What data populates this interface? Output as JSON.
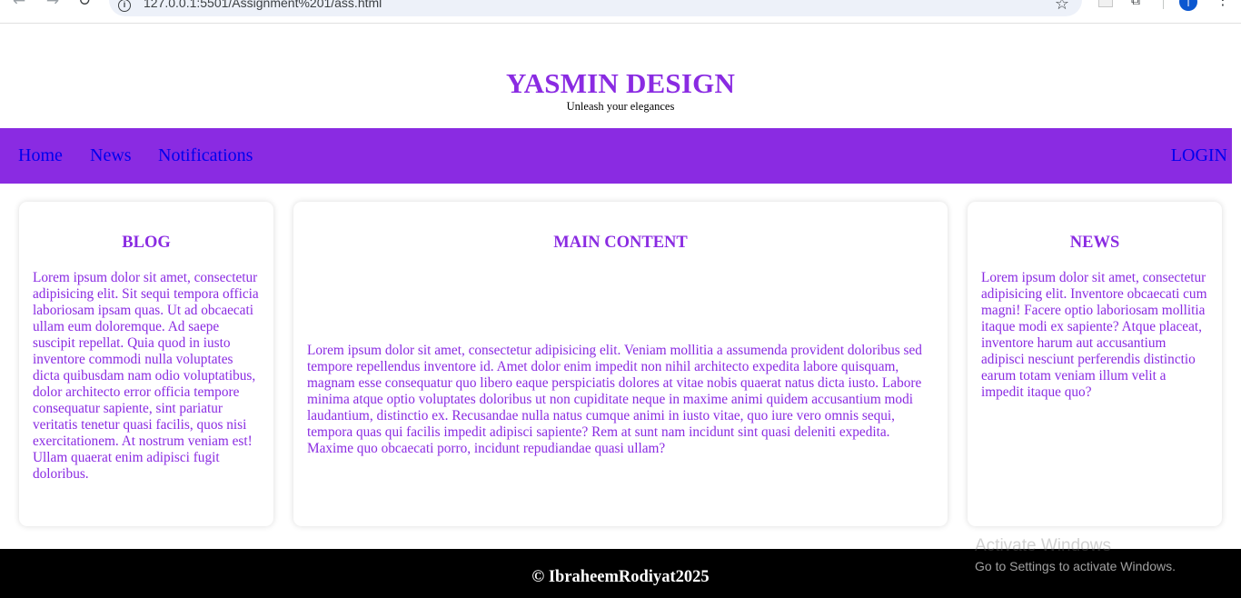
{
  "browser": {
    "url": "127.0.0.1:5501/Assignment%201/ass.html",
    "back_icon": "←",
    "forward_icon": "→",
    "reload_icon": "↻",
    "info_icon": "i",
    "star_icon": "☆",
    "extensions_icon": "⧉",
    "profile_initial": "I",
    "menu_icon": "⋮"
  },
  "header": {
    "title": "YASMIN DESIGN",
    "tagline": "Unleash your elegances"
  },
  "nav": {
    "home": "Home",
    "news": "News",
    "notifications": "Notifications",
    "login": "LOGIN"
  },
  "blog": {
    "heading": "BLOG",
    "body": "Lorem ipsum dolor sit amet, consectetur adipisicing elit. Sit sequi tempora officia laboriosam ipsam quas. Ut ad obcaecati ullam eum doloremque. Ad saepe suscipit repellat. Quia quod in iusto inventore commodi nulla voluptates dicta quibusdam nam odio voluptatibus, dolor architecto error officia tempore consequatur sapiente, sint pariatur veritatis tenetur quasi facilis, quos nisi exercitationem. At nostrum veniam est! Ullam quaerat enim adipisci fugit doloribus."
  },
  "main": {
    "heading": "MAIN CONTENT",
    "body": "Lorem ipsum dolor sit amet, consectetur adipisicing elit. Veniam mollitia a assumenda provident doloribus sed tempore repellendus inventore id. Amet dolor enim impedit non nihil architecto expedita labore quisquam, magnam esse consequatur quo libero eaque perspiciatis dolores at vitae nobis quaerat natus dicta iusto. Labore minima atque optio voluptates doloribus ut non cupiditate neque in maxime animi quidem accusantium modi laudantium, distinctio ex. Recusandae nulla natus cumque animi in iusto vitae, quo iure vero omnis sequi, tempora quas qui facilis impedit adipisci sapiente? Rem at sunt nam incidunt sint quasi deleniti expedita. Maxime quo obcaecati porro, incidunt repudiandae quasi ullam?"
  },
  "news": {
    "heading": "NEWS",
    "body": "Lorem ipsum dolor sit amet, consectetur adipisicing elit. Inventore obcaecati cum magni! Facere optio laboriosam mollitia itaque modi ex sapiente? Atque placeat, inventore harum aut accusantium adipisci nesciunt perferendis distinctio earum totam veniam illum velit a impedit itaque quo?"
  },
  "footer": {
    "text": "© IbraheemRodiyat2025"
  },
  "watermark": {
    "title": "Activate Windows",
    "subtitle": "Go to Settings to activate Windows."
  },
  "colors": {
    "brand_purple": "#8a2be2",
    "link_blue": "#0000ee",
    "footer_bg": "#000000"
  }
}
